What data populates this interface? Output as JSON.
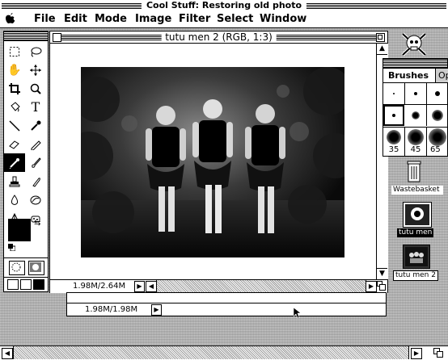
{
  "window": {
    "title": "Cool Stuff: Restoring old photo"
  },
  "menu": {
    "apple": "",
    "items": [
      "File",
      "Edit",
      "Mode",
      "Image",
      "Filter",
      "Select",
      "Window"
    ]
  },
  "document": {
    "title": "tutu men 2 (RGB, 1:3)",
    "size_readout": "1.98M/2.64M"
  },
  "second_window": {
    "size_readout": "1.98M/1.98M"
  },
  "brushes": {
    "tab_active": "Brushes",
    "tab_other": "Op",
    "sizes": [
      "35",
      "45",
      "65"
    ]
  },
  "desktop": {
    "wastebasket": "Wastebasket",
    "file1": "tutu men",
    "file2": "tutu men 2"
  },
  "icons": {
    "tools": [
      "marquee-icon",
      "lasso-icon",
      "hand-icon",
      "move-icon",
      "crop-icon",
      "zoom-icon",
      "eraser-icon",
      "type-icon",
      "brush-icon",
      "pencil-icon",
      "smudge-icon",
      "airbrush-icon",
      "pen-icon",
      "eyedropper-icon",
      "rubber-stamp-icon",
      "gradient-icon",
      "bucket-icon",
      "blur-icon",
      "dodge-icon",
      "sponge-icon"
    ]
  },
  "colors": {
    "foreground": "#000000",
    "background": "#ffffff",
    "desktop": "#b8b8b8"
  }
}
